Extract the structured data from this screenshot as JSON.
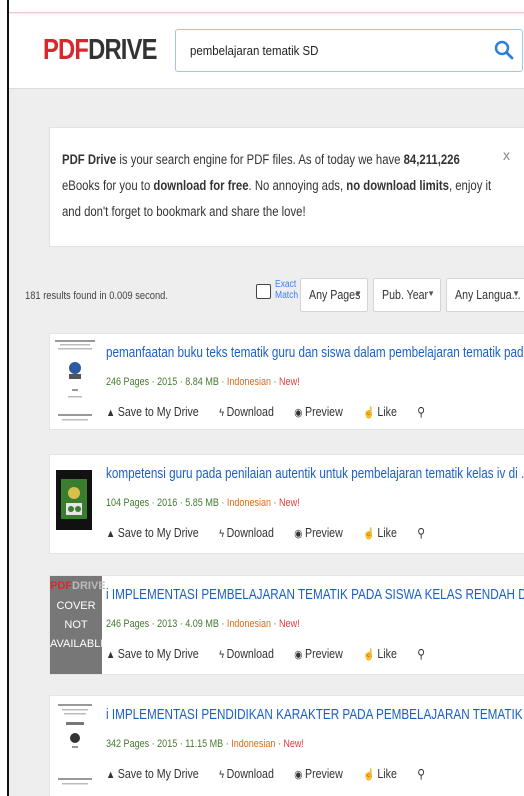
{
  "header": {
    "logo_pdf": "PDF",
    "logo_drive": "DRIVE",
    "search_value": "pembelajaran tematik SD"
  },
  "notice": {
    "t1": "PDF Drive",
    "t2": " is your search engine for PDF files. As of today we have ",
    "t3": "84,211,226",
    "t4": " eBooks for you to ",
    "t5": "download for free",
    "t6": ". No annoying ads, ",
    "t7": "no download limits",
    "t8": ", enjoy it and don't forget to bookmark and share the love!",
    "close": "x"
  },
  "results": {
    "count": "181 results found in 0.009 second.",
    "exact_1": "Exact",
    "exact_2": "Match",
    "filters": [
      "Any Pages",
      "Pub. Year",
      "Any Langua..."
    ]
  },
  "actions": {
    "save": "Save to My Drive",
    "download": "Download",
    "preview": "Preview",
    "like": "Like"
  },
  "items": [
    {
      "title": "pemanfaatan buku teks tematik guru dan siswa dalam pembelajaran tematik pad...",
      "pages": "246 Pages",
      "year": "2015",
      "size": "8.84 MB",
      "lang": "Indonesian",
      "badge": "New!"
    },
    {
      "title": "kompetensi guru pada penilaian autentik untuk pembelajaran tematik kelas iv di ...",
      "pages": "104 Pages",
      "year": "2016",
      "size": "5.85 MB",
      "lang": "Indonesian",
      "badge": "New!"
    },
    {
      "title": "i IMPLEMENTASI PEMBELAJARAN TEMATIK PADA SISWA KELAS RENDAH DI SD ...",
      "pages": "246 Pages",
      "year": "2013",
      "size": "4.09 MB",
      "lang": "Indonesian",
      "badge": "New!"
    },
    {
      "title": "i IMPLEMENTASI PENDIDIKAN KARAKTER PADA PEMBELAJARAN TEMATIK DI K...",
      "pages": "342 Pages",
      "year": "2015",
      "size": "11.15 MB",
      "lang": "Indonesian",
      "badge": "New!"
    }
  ],
  "cover_placeholder": {
    "brand_pdf": "PDF",
    "brand_drive": "DRIVE",
    "line1": "COVER",
    "line2": "NOT",
    "line3": "AVAILABLE"
  },
  "colors": {
    "brand_red": "#d9272e",
    "link_blue": "#1a5fc5",
    "meta_green": "#447a2e",
    "lang_orange": "#e06b19"
  }
}
